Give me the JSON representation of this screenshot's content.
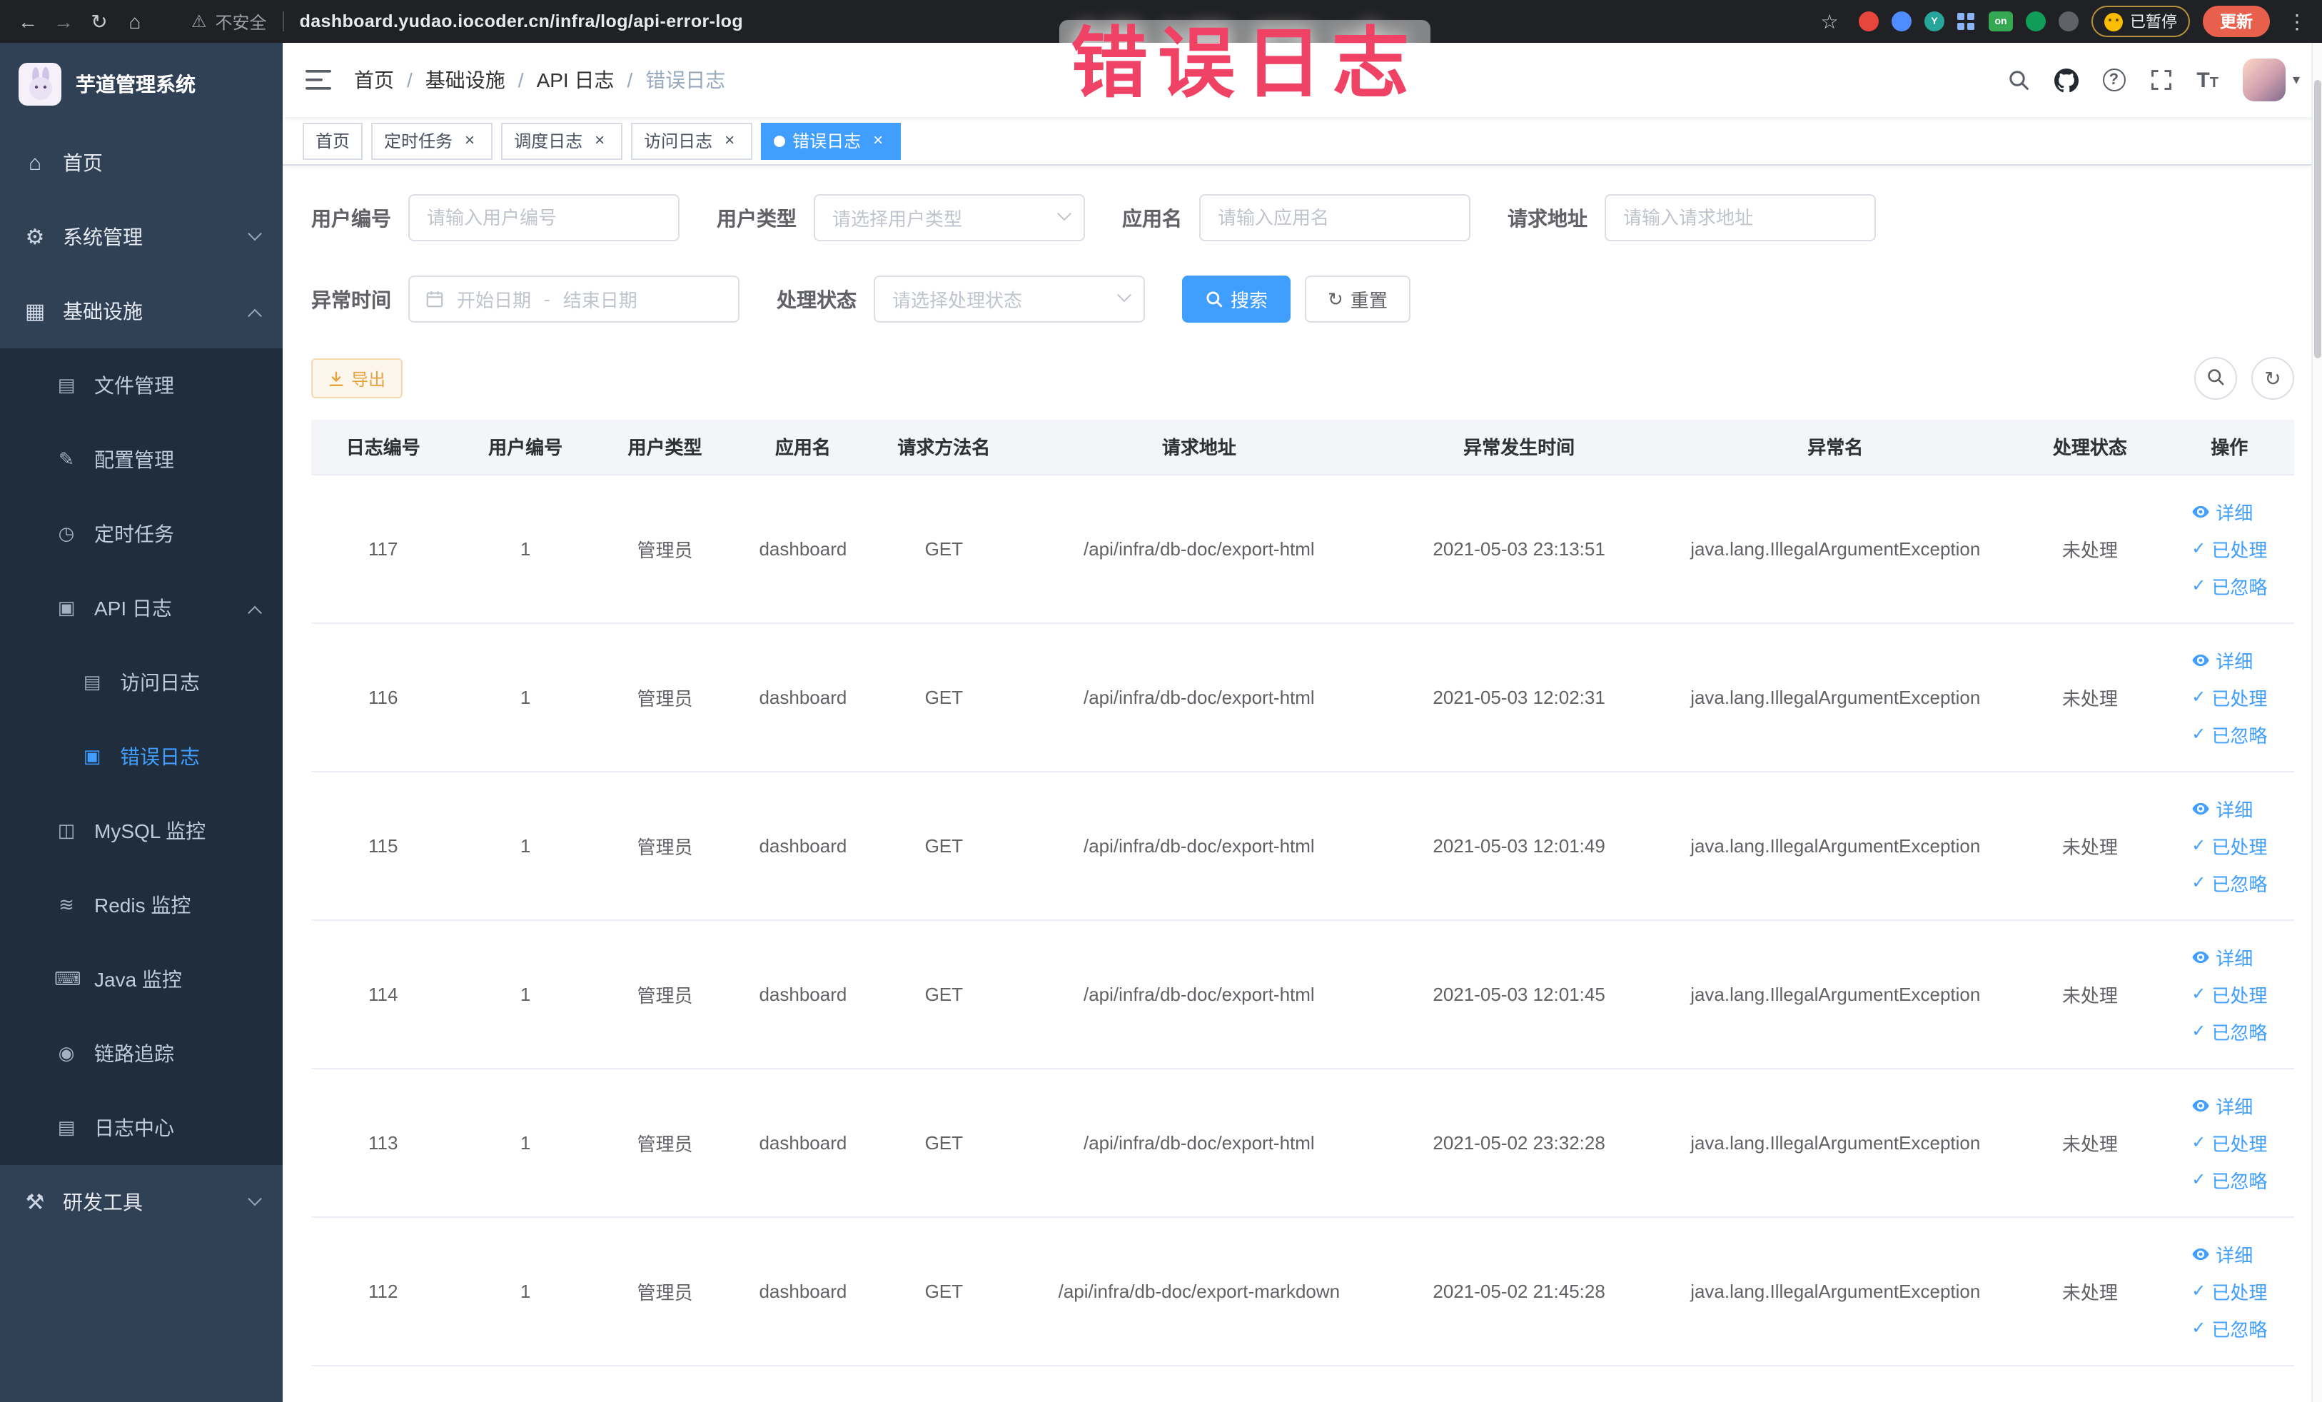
{
  "annotation": {
    "text": "错误日志"
  },
  "colors": {
    "accent": "#409eff",
    "active_tab": "#409eff",
    "warning": "#e6a23c",
    "annotation": "#ef4265",
    "sidebar_bg": "#304156",
    "submenu_bg": "#1f2d3d"
  },
  "browser": {
    "security_label": "不安全",
    "url": "dashboard.yudao.iocoder.cn/infra/log/api-error-log",
    "extension_y_badge": "Y",
    "extension_on_badge": "on",
    "paused_badge": "已暂停",
    "update_button": "更新"
  },
  "icons": {
    "back": "←",
    "forward": "→",
    "reload": "↻",
    "browser_home": "⌂",
    "warning": "⚠",
    "star": "☆",
    "more": "⋮",
    "home": "⌂",
    "system": "⚙",
    "infrastructure": "▦",
    "file": "▤",
    "config": "✎",
    "job": "◷",
    "api_log": "▣",
    "access_log": "▤",
    "error_log": "▣",
    "mysql": "◫",
    "redis": "≋",
    "java": "⌨",
    "trace": "◉",
    "log_center": "▤",
    "dev_tools": "⚒",
    "close": "×",
    "check": "✓",
    "question": "?",
    "font_size": "T",
    "caret_down": "▾",
    "refresh": "↻"
  },
  "sidebar": {
    "logo_title": "芋道管理系统",
    "home": "首页",
    "system_mgmt": "系统管理",
    "infrastructure": "基础设施",
    "file_mgmt": "文件管理",
    "config_mgmt": "配置管理",
    "scheduled_jobs": "定时任务",
    "api_log": "API 日志",
    "access_log": "访问日志",
    "error_log": "错误日志",
    "mysql_monitor": "MySQL 监控",
    "redis_monitor": "Redis 监控",
    "java_monitor": "Java 监控",
    "tracing": "链路追踪",
    "log_center": "日志中心",
    "dev_tools": "研发工具"
  },
  "navbar": {
    "separator": "/",
    "breadcrumb": [
      "首页",
      "基础设施",
      "API 日志",
      "错误日志"
    ]
  },
  "tabs": {
    "items": [
      "首页",
      "定时任务",
      "调度日志",
      "访问日志",
      "错误日志"
    ]
  },
  "filters": {
    "user_id_label": "用户编号",
    "user_id_placeholder": "请输入用户编号",
    "user_type_label": "用户类型",
    "user_type_placeholder": "请选择用户类型",
    "app_name_label": "应用名",
    "app_name_placeholder": "请输入应用名",
    "request_url_label": "请求地址",
    "request_url_placeholder": "请输入请求地址",
    "exception_time_label": "异常时间",
    "start_date_placeholder": "开始日期",
    "range_separator": "-",
    "end_date_placeholder": "结束日期",
    "process_status_label": "处理状态",
    "process_status_placeholder": "请选择处理状态",
    "search_button": "搜索",
    "reset_button": "重置"
  },
  "toolbar": {
    "export_button": "导出"
  },
  "table": {
    "columns": [
      "日志编号",
      "用户编号",
      "用户类型",
      "应用名",
      "请求方法名",
      "请求地址",
      "异常发生时间",
      "异常名",
      "处理状态",
      "操作"
    ],
    "actions": {
      "detail": "详细",
      "processed": "已处理",
      "ignored": "已忽略"
    },
    "rows": [
      {
        "id": "117",
        "user_id": "1",
        "user_type": "管理员",
        "app": "dashboard",
        "method": "GET",
        "url": "/api/infra/db-doc/export-html",
        "time": "2021-05-03 23:13:51",
        "exception": "java.lang.IllegalArgumentException",
        "status": "未处理"
      },
      {
        "id": "116",
        "user_id": "1",
        "user_type": "管理员",
        "app": "dashboard",
        "method": "GET",
        "url": "/api/infra/db-doc/export-html",
        "time": "2021-05-03 12:02:31",
        "exception": "java.lang.IllegalArgumentException",
        "status": "未处理"
      },
      {
        "id": "115",
        "user_id": "1",
        "user_type": "管理员",
        "app": "dashboard",
        "method": "GET",
        "url": "/api/infra/db-doc/export-html",
        "time": "2021-05-03 12:01:49",
        "exception": "java.lang.IllegalArgumentException",
        "status": "未处理"
      },
      {
        "id": "114",
        "user_id": "1",
        "user_type": "管理员",
        "app": "dashboard",
        "method": "GET",
        "url": "/api/infra/db-doc/export-html",
        "time": "2021-05-03 12:01:45",
        "exception": "java.lang.IllegalArgumentException",
        "status": "未处理"
      },
      {
        "id": "113",
        "user_id": "1",
        "user_type": "管理员",
        "app": "dashboard",
        "method": "GET",
        "url": "/api/infra/db-doc/export-html",
        "time": "2021-05-02 23:32:28",
        "exception": "java.lang.IllegalArgumentException",
        "status": "未处理"
      },
      {
        "id": "112",
        "user_id": "1",
        "user_type": "管理员",
        "app": "dashboard",
        "method": "GET",
        "url": "/api/infra/db-doc/export-markdown",
        "time": "2021-05-02 21:45:28",
        "exception": "java.lang.IllegalArgumentException",
        "status": "未处理"
      }
    ]
  }
}
